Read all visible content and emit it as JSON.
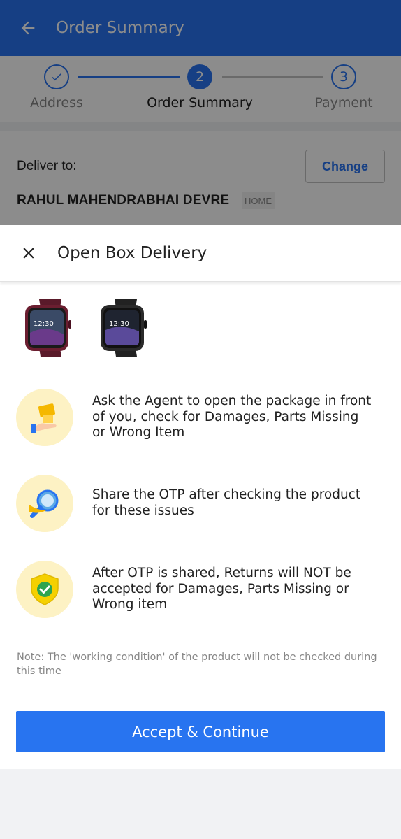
{
  "app_bar": {
    "title": "Order Summary"
  },
  "stepper": {
    "steps": [
      {
        "number": "1",
        "label": "Address",
        "state": "done"
      },
      {
        "number": "2",
        "label": "Order Summary",
        "state": "active"
      },
      {
        "number": "3",
        "label": "Payment",
        "state": "todo"
      }
    ]
  },
  "delivery": {
    "label": "Deliver to:",
    "change_label": "Change",
    "name": "RAHUL MAHENDRABHAI DEVRE",
    "address_type": "HOME"
  },
  "sheet": {
    "title": "Open Box Delivery",
    "items": [
      {
        "icon": "hand-package-icon",
        "text": "Ask the Agent to open the package in front of you, check for Damages, Parts Missing or Wrong Item"
      },
      {
        "icon": "magnifier-icon",
        "text": "Share the OTP after checking the product for these issues"
      },
      {
        "icon": "shield-check-icon",
        "text": "After OTP is shared, Returns will NOT be accepted for Damages, Parts Missing or Wrong item"
      }
    ],
    "note": "Note: The 'working condition' of the product will not be checked during this time",
    "accept_label": "Accept & Continue",
    "watch_time": "12:30"
  },
  "colors": {
    "brand": "#2874f0",
    "icon_bg": "#fdf2c4",
    "overlay": "rgba(0,0,0,0.45)"
  }
}
